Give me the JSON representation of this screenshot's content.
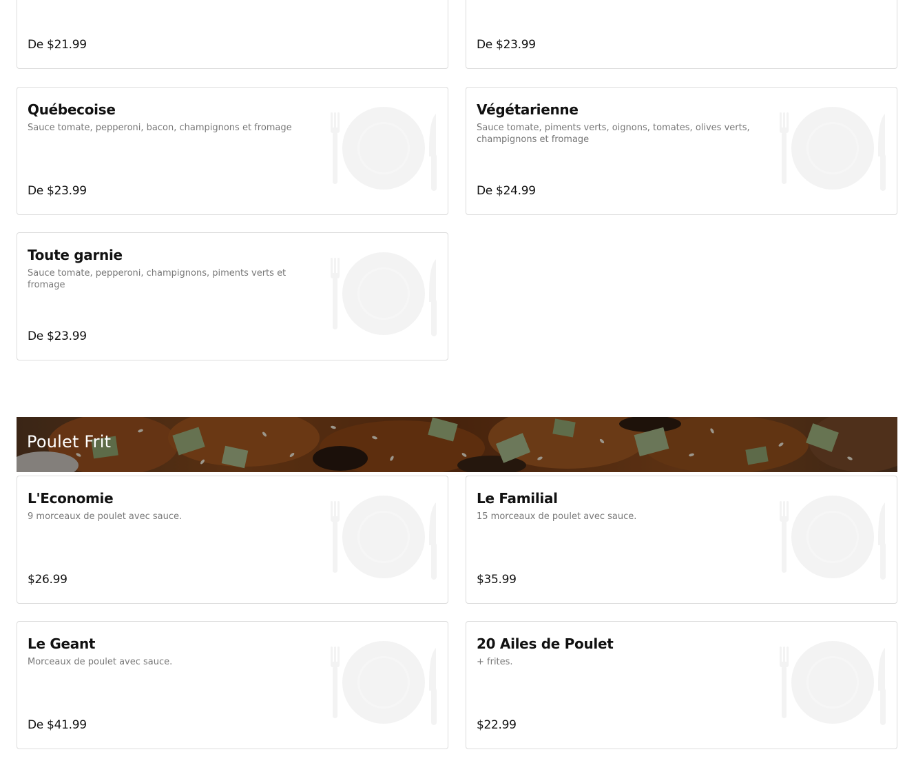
{
  "menu_sections": [
    {
      "items": [
        {
          "name": "",
          "description": "",
          "price": "De $21.99"
        },
        {
          "name": "",
          "description": "",
          "price": "De $23.99"
        },
        {
          "name": "Québecoise",
          "description": "Sauce tomate, pepperoni, bacon, champignons et fromage",
          "price": "De $23.99"
        },
        {
          "name": "Végétarienne",
          "description": "Sauce tomate, piments verts, oignons, tomates, olives verts, champignons et fromage",
          "price": "De $24.99"
        },
        {
          "name": "Toute garnie",
          "description": "Sauce tomate, pepperoni, champignons, piments verts et fromage",
          "price": "De $23.99"
        }
      ]
    },
    {
      "title": "Poulet Frit",
      "items": [
        {
          "name": "L'Economie",
          "description": "9 morceaux de poulet avec sauce.",
          "price": "$26.99"
        },
        {
          "name": "Le Familial",
          "description": "15 morceaux de poulet avec sauce.",
          "price": "$35.99"
        },
        {
          "name": "Le Geant",
          "description": "Morceaux de poulet avec sauce.",
          "price": "De $41.99"
        },
        {
          "name": "20 Ailes de Poulet",
          "description": "+ frites.",
          "price": "$22.99"
        }
      ]
    }
  ],
  "placeholder_icon": "plate-fork-knife-icon",
  "colors": {
    "card_border": "#dcdcdc",
    "description_text": "#777777",
    "banner_overlay": "#000000"
  }
}
